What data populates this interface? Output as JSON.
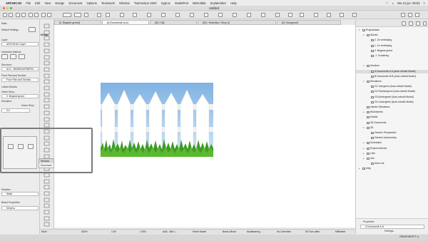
{
  "menubar": {
    "apple": "",
    "items": [
      "ARCHICAD",
      "File",
      "Edit",
      "View",
      "Design",
      "Document",
      "Options",
      "Teamwork",
      "Window",
      "Twinmotion 2020",
      "Gyproc",
      "ModelPort",
      "BIMcollab",
      "KeyMember",
      "Help"
    ],
    "clock": "Wo 24 jun. 09:52"
  },
  "window": {
    "title": "Untitled"
  },
  "tabs": [
    "[0. Begane grond]",
    "[A Doorsnede A-A]",
    "[3D / All]",
    "[3D / Selection, Story 0]",
    "[01 Voorgevel]"
  ],
  "infobox": {
    "main_label": "Main:",
    "default_settings": "Default Settings",
    "layer_label": "Layer:",
    "layer_value": "ARCHICAD Layer",
    "geometry_label": "Geometry Method:",
    "structure_label": "Structure:",
    "structure_value": "ALG - BINNENAFWERKI...",
    "floorplan_label": "Floor Plan and Section:",
    "floorplan_value": "Floor Plan and Section...",
    "linked_label": "Linked Stories:",
    "home_label": "Home Story:",
    "home_value": "0. Begane grond",
    "elevation_label": "Elevation:",
    "home_story": "Home Story",
    "elevation_value": "0,0",
    "window_item": "Window",
    "document_item": "Document",
    "relation_label": "Relation:",
    "relation_value": "Walls",
    "brand_label": "Brand Properties:",
    "brand_value": "Morph ▸",
    "design_tab": "Design"
  },
  "canvas": {
    "image": "picket-fence-with-grass",
    "sky_top": "#7fb2e3",
    "sky_bottom": "#cfe6f6",
    "grass": "#3b9b24"
  },
  "statusbar": {
    "items": [
      "632%",
      "1:50",
      "1:500",
      "AAA - Alle L...",
      "Entire Model",
      "Basis Uitvoe",
      "Modelweerg...",
      "No Overrides",
      "06 Toon alles",
      "Millimeter"
    ],
    "more": "More"
  },
  "navigator": {
    "rows": [
      {
        "text": "Projectnaam",
        "indent": 0,
        "tw": "▾"
      },
      {
        "text": "Stories",
        "indent": 1,
        "tw": "▾"
      },
      {
        "text": "2. 2e verdieping",
        "indent": 2,
        "tw": ""
      },
      {
        "text": "1. 1e verdieping",
        "indent": 2,
        "tw": ""
      },
      {
        "text": "0. Begane grond",
        "indent": 2,
        "tw": ""
      },
      {
        "text": "-1. Fundering",
        "indent": 2,
        "tw": ""
      },
      {
        "text": "",
        "indent": 0,
        "tw": ""
      },
      {
        "text": "Sections",
        "indent": 1,
        "tw": "▾"
      },
      {
        "text": "A Doorsnede A-A (Auto-rebuild Model)",
        "indent": 2,
        "tw": "",
        "sel": true
      },
      {
        "text": "B Doorsnede B-B (Auto-rebuild Model)",
        "indent": 2,
        "tw": ""
      },
      {
        "text": "Elevations",
        "indent": 1,
        "tw": "▾"
      },
      {
        "text": "G1 Voorgevel (Auto-rebuild Model)",
        "indent": 2,
        "tw": ""
      },
      {
        "text": "G2 Rechtergevel (Auto-rebuild Model)",
        "indent": 2,
        "tw": ""
      },
      {
        "text": "G3 Achtergevel (Auto-rebuild Model)",
        "indent": 2,
        "tw": ""
      },
      {
        "text": "G4 Linkergevel (Auto-rebuild Model)",
        "indent": 2,
        "tw": ""
      },
      {
        "text": "Interior Elevations",
        "indent": 1,
        "tw": ""
      },
      {
        "text": "Worksheets",
        "indent": 1,
        "tw": "▸"
      },
      {
        "text": "Details",
        "indent": 1,
        "tw": ""
      },
      {
        "text": "3D Documents",
        "indent": 1,
        "tw": ""
      },
      {
        "text": "3D",
        "indent": 1,
        "tw": "▾"
      },
      {
        "text": "Generic Perspective",
        "indent": 2,
        "tw": ""
      },
      {
        "text": "Generic Axonometry",
        "indent": 2,
        "tw": ""
      },
      {
        "text": "Schedules",
        "indent": 1,
        "tw": "▸"
      },
      {
        "text": "Project Indexes",
        "indent": 1,
        "tw": "▸"
      },
      {
        "text": "Lists",
        "indent": 1,
        "tw": "▸"
      },
      {
        "text": "Info",
        "indent": 1,
        "tw": "▸"
      },
      {
        "text": "Area List",
        "indent": 2,
        "tw": ""
      },
      {
        "text": "Help",
        "indent": 0,
        "tw": "▸"
      }
    ],
    "properties_label": "Properties",
    "properties_value": "A    Doorsnede A-A",
    "settings_button": "Settings...",
    "brand": "GRAPHISOFT ◎"
  }
}
